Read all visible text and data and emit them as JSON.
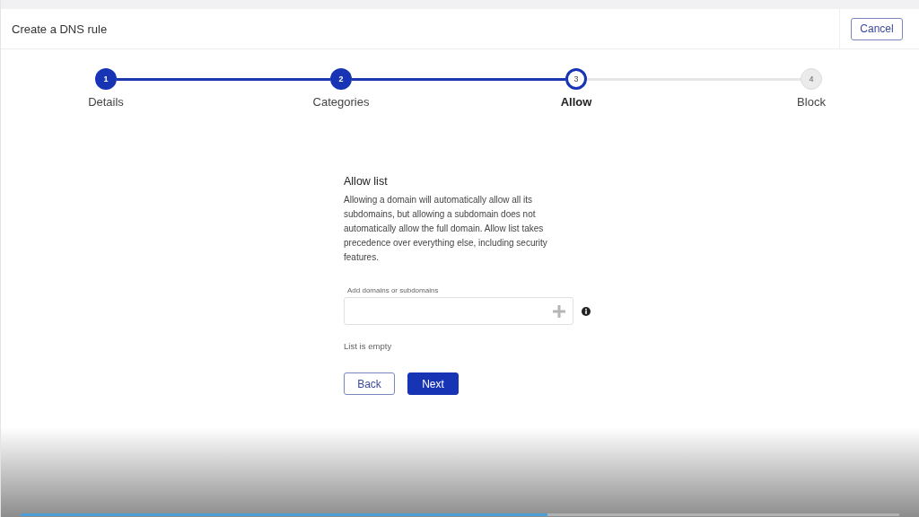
{
  "header": {
    "title": "Create a DNS rule",
    "cancel": "Cancel"
  },
  "steps": [
    {
      "number": "1",
      "label": "Details",
      "completed": true,
      "selected": false
    },
    {
      "number": "2",
      "label": "Categories",
      "completed": true,
      "selected": false
    },
    {
      "number": "3",
      "label": "Allow",
      "completed": false,
      "selected": true
    },
    {
      "number": "4",
      "label": "Block",
      "completed": false,
      "selected": false
    }
  ],
  "allow_list": {
    "title": "Allow list",
    "description": "Allowing a domain will automatically allow all its subdomains, but allowing a subdomain does not automatically allow the full domain. Allow list takes precedence over everything else, including security features.",
    "field_label": "Add domains or subdomains",
    "empty_text": "List is empty"
  },
  "buttons": {
    "back": "Back",
    "next": "Next"
  },
  "video_player": {
    "level": 0.6
  }
}
